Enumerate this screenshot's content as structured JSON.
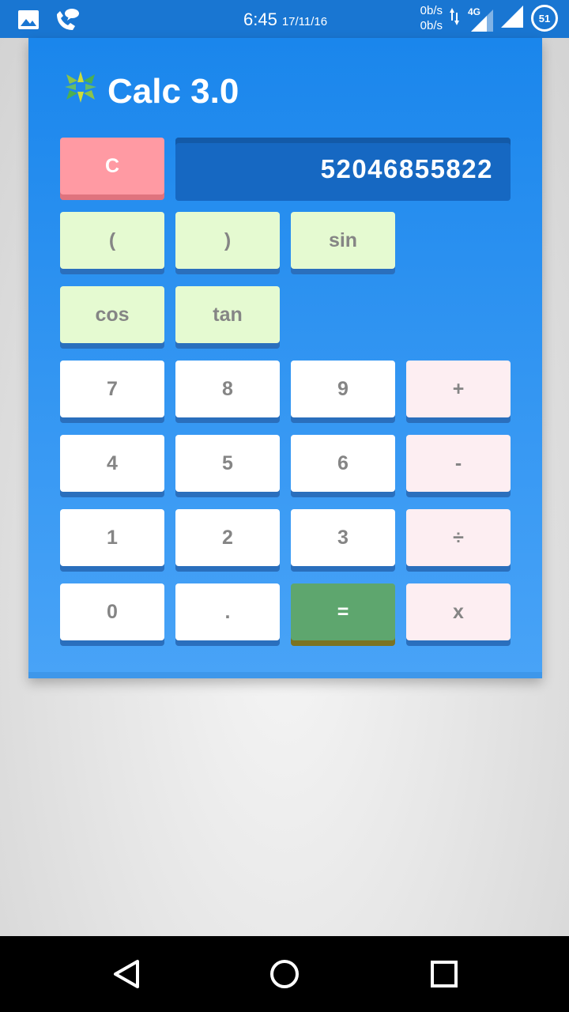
{
  "status_bar": {
    "time": "6:45",
    "date": "17/11/16",
    "net_up": "0b/s",
    "net_down": "0b/s",
    "network_type": "4G",
    "battery": "51"
  },
  "app": {
    "title": "Calc 3.0",
    "display_value": "52046855822"
  },
  "keys": {
    "clear": "C",
    "open_paren": "(",
    "close_paren": ")",
    "sin": "sin",
    "cos": "cos",
    "tan": "tan",
    "seven": "7",
    "eight": "8",
    "nine": "9",
    "plus": "+",
    "four": "4",
    "five": "5",
    "six": "6",
    "minus": "-",
    "one": "1",
    "two": "2",
    "three": "3",
    "divide": "÷",
    "zero": "0",
    "dot": ".",
    "equals": "=",
    "multiply": "x"
  },
  "colors": {
    "card_top": "#1a86ec",
    "card_bottom": "#48a3f7",
    "display": "#1668c2",
    "clear": "#ff9aa3",
    "function_key": "#e5fad1",
    "operator_key": "#fdeef2",
    "equals_key": "#5ea66e",
    "status_bar": "#1976d2"
  },
  "icons": [
    "gallery-icon",
    "call-message-icon",
    "data-arrows-icon",
    "signal-icon",
    "battery-icon",
    "app-logo-icon",
    "back-icon",
    "home-icon",
    "recents-icon"
  ]
}
